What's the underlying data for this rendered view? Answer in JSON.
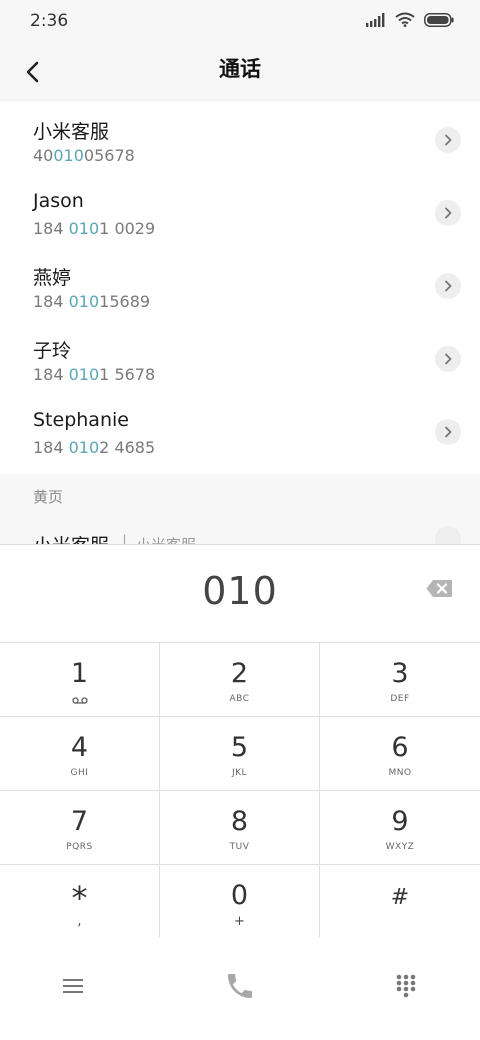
{
  "status": {
    "time": "2:36"
  },
  "header": {
    "title": "通话"
  },
  "contacts": [
    {
      "name": "小米客服",
      "number_pre": "40",
      "number_hl": "010",
      "number_post": "05678"
    },
    {
      "name": "Jason",
      "number_pre": "184 ",
      "number_hl": "010",
      "number_post": "1 0029"
    },
    {
      "name": "燕婷",
      "number_pre": "184 ",
      "number_hl": "010",
      "number_post": "15689"
    },
    {
      "name": "子玲",
      "number_pre": "184 ",
      "number_hl": "010",
      "number_post": "1 5678"
    },
    {
      "name": "Stephanie",
      "number_pre": "184 ",
      "number_hl": "010",
      "number_post": "2 4685"
    }
  ],
  "yellow_pages": {
    "label": "黄页",
    "item": {
      "name": "小米客服",
      "separator": "|",
      "subtitle": "小米客服"
    }
  },
  "dialer": {
    "input": "010",
    "keys": [
      {
        "digit": "1",
        "letters": ""
      },
      {
        "digit": "2",
        "letters": "ABC"
      },
      {
        "digit": "3",
        "letters": "DEF"
      },
      {
        "digit": "4",
        "letters": "GHI"
      },
      {
        "digit": "5",
        "letters": "JKL"
      },
      {
        "digit": "6",
        "letters": "MNO"
      },
      {
        "digit": "7",
        "letters": "PQRS"
      },
      {
        "digit": "8",
        "letters": "TUV"
      },
      {
        "digit": "9",
        "letters": "WXYZ"
      },
      {
        "digit": "*",
        "letters": ","
      },
      {
        "digit": "0",
        "letters": "+"
      },
      {
        "digit": "#",
        "letters": ""
      }
    ]
  },
  "icons": {
    "back": "back-arrow-icon",
    "detail": "chevron-right-icon",
    "backspace": "backspace-icon",
    "menu": "menu-icon",
    "call": "phone-icon",
    "keypad": "keypad-icon"
  },
  "colors": {
    "highlight": "#5aa6b6",
    "call_icon": "#a8a8a8"
  }
}
